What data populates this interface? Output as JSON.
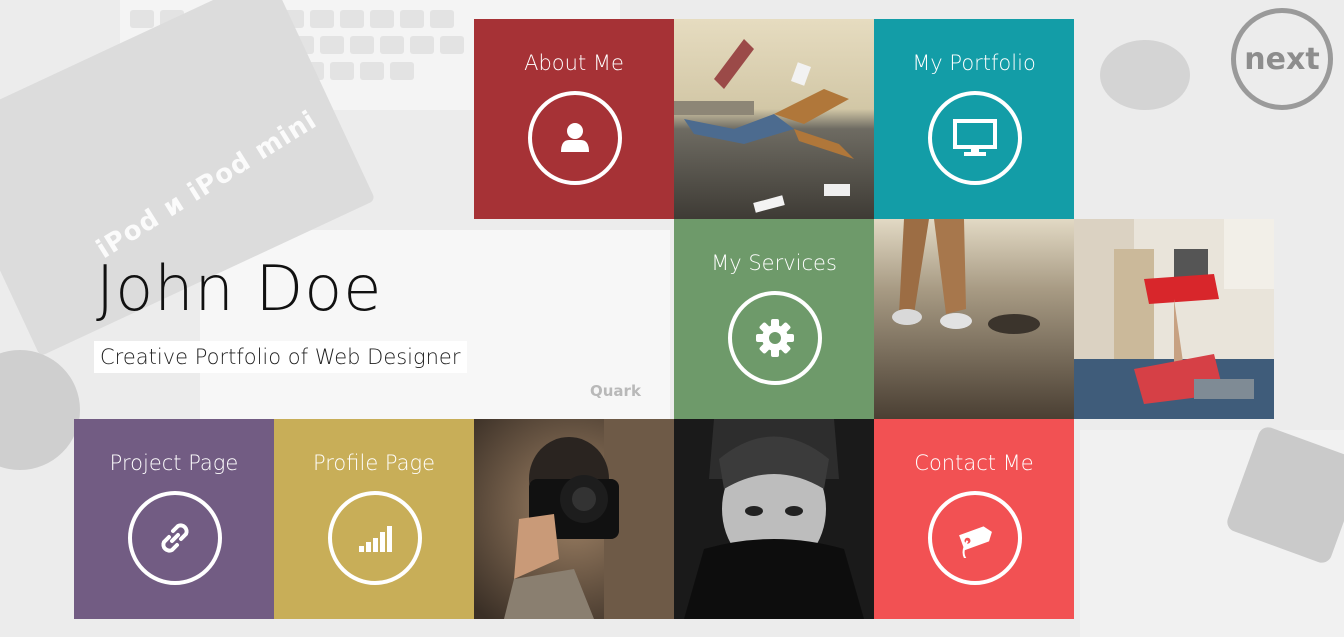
{
  "profile": {
    "name": "John Doe",
    "tagline": "Creative Portfolio of Web Designer"
  },
  "navigation": {
    "next_label": "next"
  },
  "tiles": {
    "about": {
      "label": "About Me",
      "color": "#a63236",
      "icon": "user-icon"
    },
    "portfolio": {
      "label": "My Portfolio",
      "color": "#139da7",
      "icon": "monitor-icon"
    },
    "services": {
      "label": "My Services",
      "color": "#6e9a6a",
      "icon": "gear-icon"
    },
    "project": {
      "label": "Project Page",
      "color": "#725c83",
      "icon": "link-icon"
    },
    "profile_page": {
      "label": "Profile Page",
      "color": "#c8ae58",
      "icon": "bar-chart-icon"
    },
    "contact": {
      "label": "Contact Me",
      "color": "#f25153",
      "icon": "tag-icon"
    }
  },
  "background": {
    "box_text": "iPod и iPod mini",
    "brand_text": "Quark"
  }
}
